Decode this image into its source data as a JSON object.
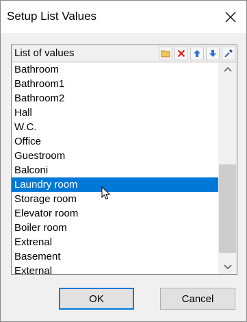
{
  "dialog": {
    "title": "Setup List Values"
  },
  "panel": {
    "header": "List of values",
    "toolbar": [
      {
        "name": "folder-icon",
        "color": "#e8b84a"
      },
      {
        "name": "delete-icon",
        "color": "#e02020"
      },
      {
        "name": "move-up-icon",
        "color": "#2a6fd6"
      },
      {
        "name": "move-down-icon",
        "color": "#2a6fd6"
      },
      {
        "name": "picker-icon",
        "color": "#3a5ea8"
      }
    ]
  },
  "list": {
    "items": [
      "Bathroom",
      "Bathroom1",
      "Bathroom2",
      "Hall",
      "W.C.",
      "Office",
      "Guestroom",
      "Balconi",
      "Laundry room",
      "Storage room",
      "Elevator room",
      "Boiler room",
      "Extrenal",
      "Basement",
      "External"
    ],
    "selected_index": 8,
    "scroll": {
      "thumb_start": 0.48,
      "thumb_end": 0.96
    }
  },
  "buttons": {
    "ok": "OK",
    "cancel": "Cancel"
  },
  "colors": {
    "selection": "#0078d7",
    "default_button_border": "#0078d7"
  }
}
